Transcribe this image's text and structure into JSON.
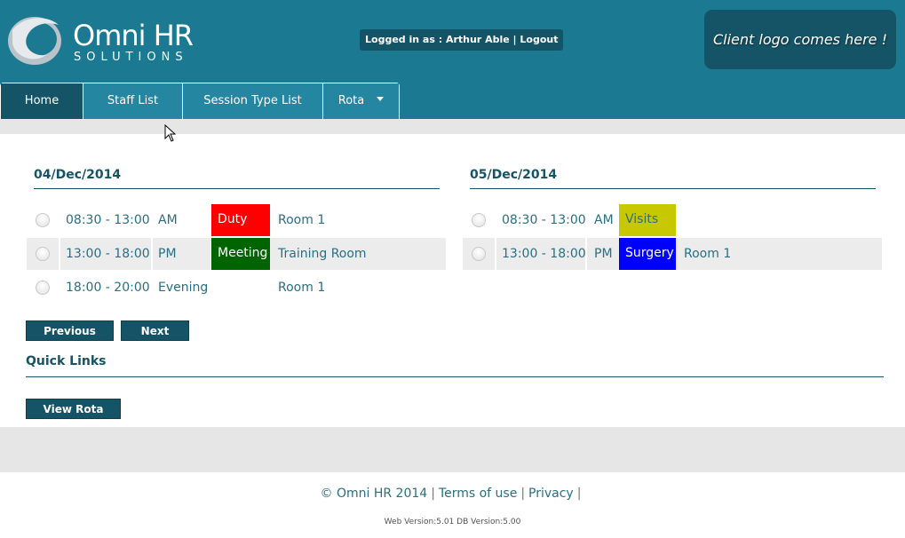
{
  "header": {
    "logo_main": "Omni HR",
    "logo_sub": "SOLUTIONS",
    "login_prefix": "Logged in as : ",
    "user_name": "Arthur Able",
    "login_divider": " | ",
    "logout_label": "Logout",
    "client_logo_text": "Client logo comes here !"
  },
  "nav": {
    "items": [
      {
        "label": "Home",
        "active": true
      },
      {
        "label": "Staff List"
      },
      {
        "label": "Session Type List"
      },
      {
        "label": "Rota",
        "dropdown": true
      }
    ]
  },
  "days": [
    {
      "date": "04/Dec/2014",
      "sessions": [
        {
          "time": "08:30 - 13:00",
          "period": "AM",
          "type": "Duty",
          "type_color": "#ff0000",
          "type_text_color": "#ffffff",
          "room": "Room 1"
        },
        {
          "time": "13:00 - 18:00",
          "period": "PM",
          "type": "Meeting",
          "type_color": "#006400",
          "type_text_color": "#ffffff",
          "room": "Training Room"
        },
        {
          "time": "18:00 - 20:00",
          "period": "Evening",
          "type": "",
          "type_color": "",
          "type_text_color": "",
          "room": "Room 1"
        }
      ]
    },
    {
      "date": "05/Dec/2014",
      "sessions": [
        {
          "time": "08:30 - 13:00",
          "period": "AM",
          "type": "Visits",
          "type_color": "#c8c800",
          "type_text_color": "#2a6f82",
          "room": ""
        },
        {
          "time": "13:00 - 18:00",
          "period": "PM",
          "type": "Surgery",
          "type_color": "#0000ff",
          "type_text_color": "#ffffff",
          "room": "Room 1"
        }
      ]
    }
  ],
  "buttons": {
    "previous": "Previous",
    "next": "Next",
    "view_rota": "View Rota"
  },
  "quick_links": {
    "title": "Quick Links"
  },
  "footer": {
    "copyright": "© Omni HR 2014",
    "terms": "Terms of use",
    "privacy": "Privacy",
    "divider": "|",
    "version": "Web Version:5.01 DB Version:5.00"
  },
  "colors": {
    "header_bg": "#1b7a91",
    "dark_teal": "#155466",
    "nav_bg": "#2486a1",
    "text_teal": "#2a6f82"
  }
}
